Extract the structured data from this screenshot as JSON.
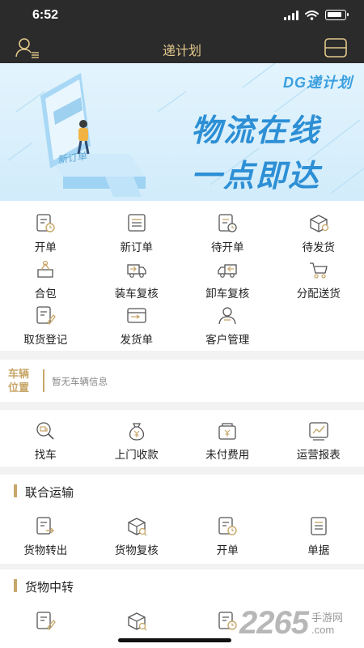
{
  "status_bar": {
    "time": "6:52"
  },
  "nav": {
    "title": "递计划",
    "left_icon": "user-list-icon",
    "right_icon": "switch-card-icon"
  },
  "banner": {
    "brand": "DG递计划",
    "line1": "物流在线",
    "line2": "一点即达",
    "phone_text": "新订单"
  },
  "colors": {
    "accent": "#c7a76a",
    "nav_bg": "#2b2b2b",
    "nav_title": "#e3c98c",
    "banner_text": "#2d8fd5"
  },
  "main_grid": [
    {
      "label": "开单",
      "icon": "order-clock-icon"
    },
    {
      "label": "新订单",
      "icon": "list-doc-icon"
    },
    {
      "label": "待开单",
      "icon": "pending-doc-icon"
    },
    {
      "label": "待发货",
      "icon": "box-icon"
    },
    {
      "label": "合包",
      "icon": "merge-package-icon"
    },
    {
      "label": "装车复核",
      "icon": "truck-load-icon"
    },
    {
      "label": "卸车复核",
      "icon": "truck-unload-icon"
    },
    {
      "label": "分配送货",
      "icon": "cart-icon"
    },
    {
      "label": "取货登记",
      "icon": "pen-doc-icon"
    },
    {
      "label": "发货单",
      "icon": "shipping-bill-icon"
    },
    {
      "label": "客户管理",
      "icon": "customers-icon"
    }
  ],
  "vehicle": {
    "label_line1": "车辆",
    "label_line2": "位置",
    "info": "暂无车辆信息"
  },
  "tools_grid": [
    {
      "label": "找车",
      "icon": "find-truck-icon"
    },
    {
      "label": "上门收款",
      "icon": "money-bag-icon"
    },
    {
      "label": "未付费用",
      "icon": "unpaid-icon"
    },
    {
      "label": "运营报表",
      "icon": "report-chart-icon"
    }
  ],
  "section_joint": {
    "title": "联合运输"
  },
  "joint_grid": [
    {
      "label": "货物转出",
      "icon": "goods-out-icon"
    },
    {
      "label": "货物复核",
      "icon": "goods-check-icon"
    },
    {
      "label": "开单",
      "icon": "order-clock-icon"
    },
    {
      "label": "单据",
      "icon": "document-icon"
    }
  ],
  "section_transfer": {
    "title": "货物中转"
  },
  "watermark": {
    "number": "2265",
    "text_line1": "手游网",
    "text_line2": ".com"
  }
}
